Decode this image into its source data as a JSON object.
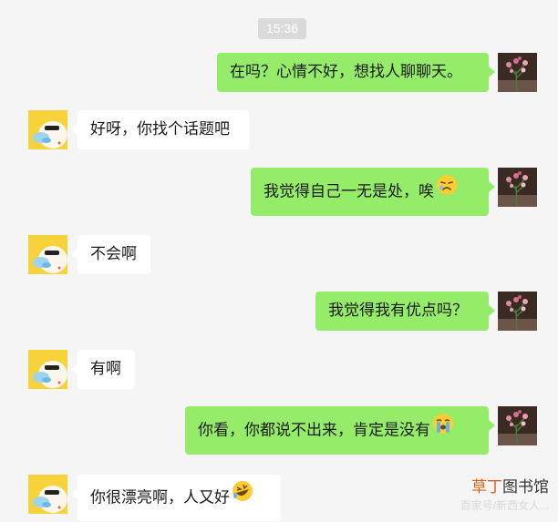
{
  "timestamp": "15:36",
  "messages": [
    {
      "sender": "me",
      "text": "在吗？心情不好，想找人聊聊天。",
      "emoji": null
    },
    {
      "sender": "friend",
      "text": "好呀，你找个话题吧",
      "emoji": null
    },
    {
      "sender": "me",
      "text": "我觉得自己一无是处，唉",
      "emoji": "sad-face-emoji"
    },
    {
      "sender": "friend",
      "text": "不会啊",
      "emoji": null
    },
    {
      "sender": "me",
      "text": "我觉得我有优点吗？",
      "emoji": null
    },
    {
      "sender": "friend",
      "text": "有啊",
      "emoji": null
    },
    {
      "sender": "me",
      "text": "你看，你都说不出来，肯定是没有",
      "emoji": "crying-face-emoji"
    },
    {
      "sender": "friend",
      "text": "你很漂亮啊，人又好",
      "emoji": "rolling-laughing-emoji"
    }
  ],
  "watermark": {
    "brand_part1": "草丁",
    "brand_part2": "图书馆",
    "subtitle": "百家号/新西女人..."
  },
  "colors": {
    "my_bubble": "#95ec69",
    "friend_bubble": "#ffffff",
    "background": "#f5f5f5",
    "timestamp_bg": "#dadada"
  }
}
